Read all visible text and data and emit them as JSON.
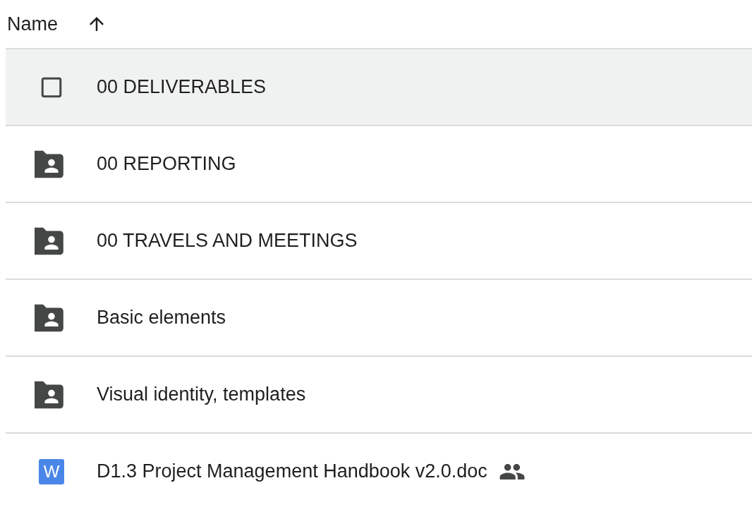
{
  "header": {
    "label": "Name"
  },
  "rows": [
    {
      "name": "00 DELIVERABLES",
      "hovered": true,
      "shared": false
    },
    {
      "name": "00 REPORTING",
      "kind": "folder",
      "hovered": false,
      "shared": false
    },
    {
      "name": "00 TRAVELS AND MEETINGS",
      "kind": "folder",
      "hovered": false,
      "shared": false
    },
    {
      "name": "Basic elements",
      "kind": "folder",
      "hovered": false,
      "shared": false
    },
    {
      "name": "Visual identity, templates",
      "kind": "folder",
      "hovered": false,
      "shared": false
    },
    {
      "name": "D1.3 Project Management Handbook v2.0.doc",
      "kind": "doc",
      "badge": "W",
      "hovered": false,
      "shared": true
    }
  ]
}
